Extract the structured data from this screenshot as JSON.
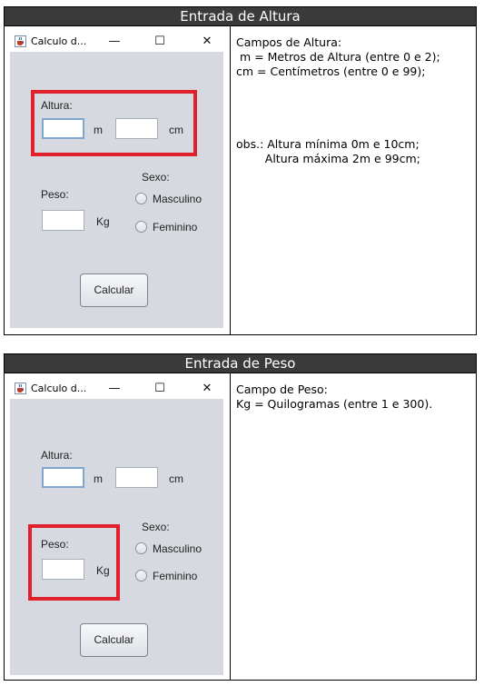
{
  "sections": [
    {
      "header": "Entrada de Altura",
      "window": {
        "title": "Calculo d...",
        "minimize": "—",
        "maximize": "☐",
        "close": "✕",
        "altura_label": "Altura:",
        "m_label": "m",
        "cm_label": "cm",
        "sexo_label": "Sexo:",
        "peso_label": "Peso:",
        "kg_label": "Kg",
        "masculino": "Masculino",
        "feminino": "Feminino",
        "calcular": "Calcular"
      },
      "notes": [
        "Campos de Altura:",
        " m = Metros de Altura (entre 0 e 2);",
        "cm = Centímetros (entre 0 e 99);",
        "",
        "",
        "",
        "",
        "obs.: Altura mínima 0m e 10cm;",
        "        Altura máxima 2m e 99cm;"
      ]
    },
    {
      "header": "Entrada de Peso",
      "window": {
        "title": "Calculo d...",
        "minimize": "—",
        "maximize": "☐",
        "close": "✕",
        "altura_label": "Altura:",
        "m_label": "m",
        "cm_label": "cm",
        "sexo_label": "Sexo:",
        "peso_label": "Peso:",
        "kg_label": "Kg",
        "masculino": "Masculino",
        "feminino": "Feminino",
        "calcular": "Calcular"
      },
      "notes": [
        "Campo de Peso:",
        "Kg = Quilogramas (entre 1 e 300)."
      ]
    }
  ],
  "colors": {
    "highlight": "#e0202a",
    "header_bg": "#3a3a3a",
    "window_bg": "#d6d9df"
  },
  "icons": {
    "app_icon": "java-cup-icon"
  }
}
